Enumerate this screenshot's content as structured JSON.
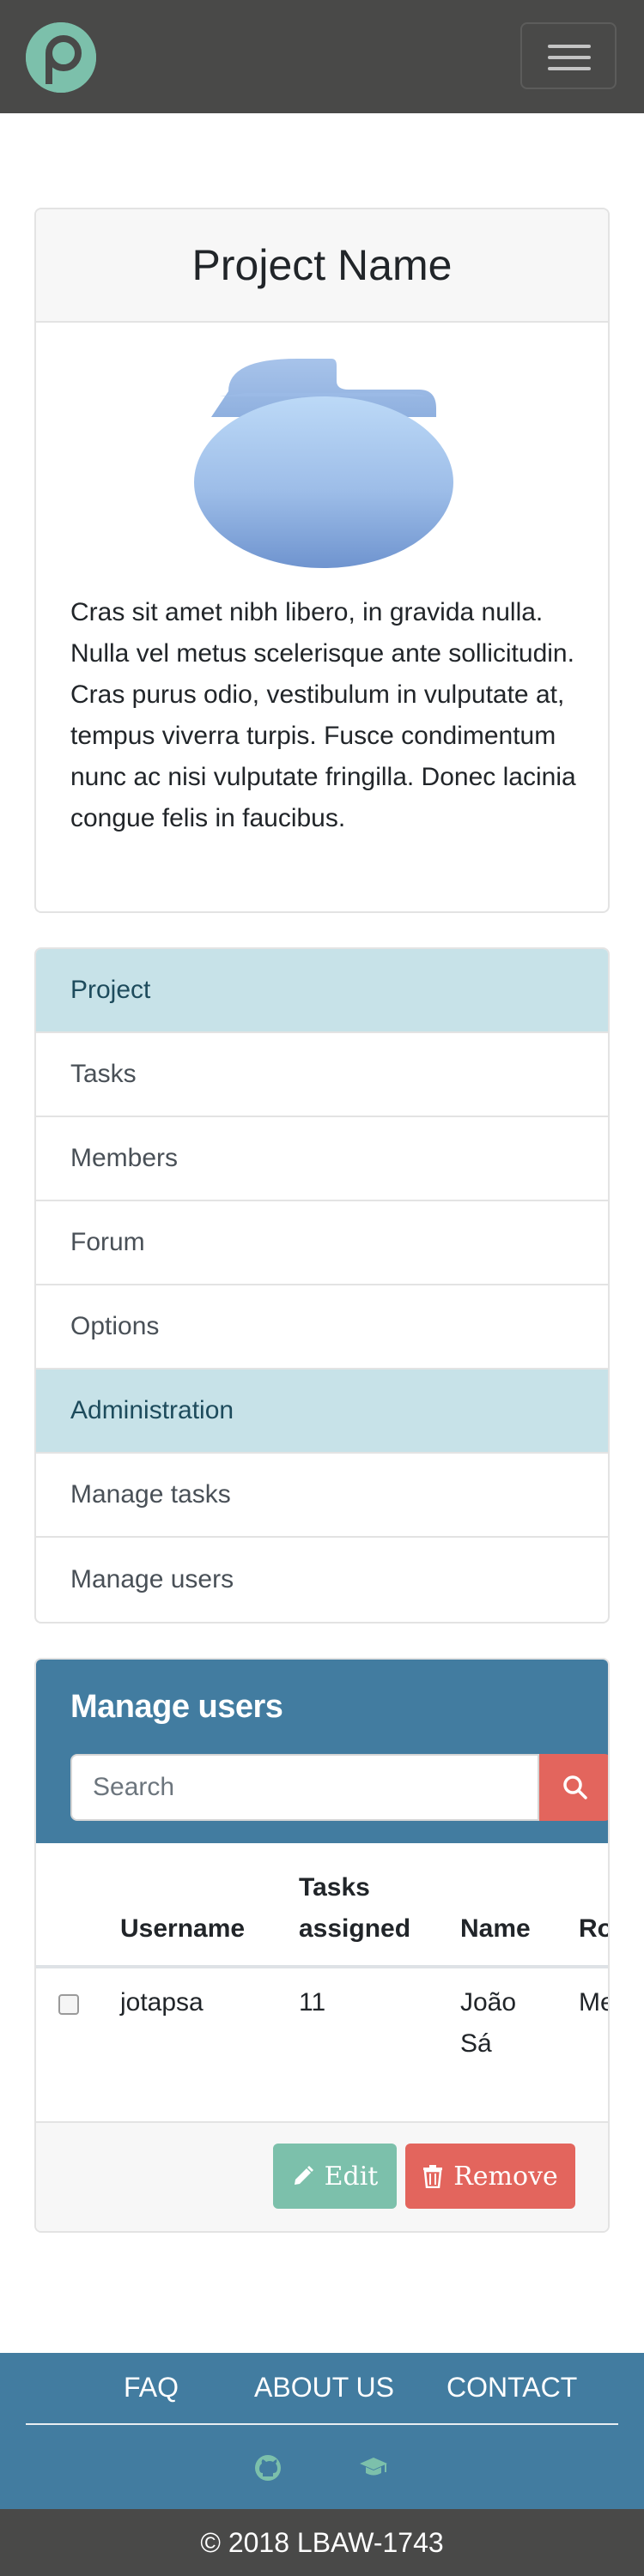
{
  "navbar": {
    "logo_icon": "p-logo-icon",
    "menu_icon": "hamburger-icon"
  },
  "project": {
    "title": "Project Name",
    "image_icon": "folder-icon",
    "description": "Cras sit amet nibh libero, in gravida nulla. Nulla vel metus scelerisque ante sollicitudin. Cras purus odio, vestibulum in vulputate at, tempus viverra turpis. Fusce condimentum nunc ac nisi vulputate fringilla. Donec lacinia congue felis in faucibus."
  },
  "sidebar": {
    "items": [
      {
        "label": "Project",
        "active": true
      },
      {
        "label": "Tasks",
        "active": false
      },
      {
        "label": "Members",
        "active": false
      },
      {
        "label": "Forum",
        "active": false
      },
      {
        "label": "Options",
        "active": false
      },
      {
        "label": "Administration",
        "active": true
      },
      {
        "label": "Manage tasks",
        "active": false
      },
      {
        "label": "Manage users",
        "active": false
      }
    ]
  },
  "manage_users": {
    "title": "Manage users",
    "search_placeholder": "Search",
    "columns": [
      "Username",
      "Tasks assigned",
      "Name",
      "Ro"
    ],
    "rows": [
      {
        "username": "jotapsa",
        "tasks_assigned": "11",
        "name": "João Sá",
        "role": "Me"
      }
    ],
    "edit_label": "Edit",
    "remove_label": "Remove"
  },
  "footer": {
    "links": [
      "FAQ",
      "ABOUT US",
      "CONTACT"
    ],
    "icons": [
      "github-icon",
      "graduation-cap-icon"
    ],
    "copyright": "© 2018 LBAW-1743"
  },
  "colors": {
    "navbar": "#494948",
    "brand": "#7cc0ab",
    "header_blue": "#427ca0",
    "danger": "#e3655d",
    "active_item": "#c7e2e8"
  }
}
